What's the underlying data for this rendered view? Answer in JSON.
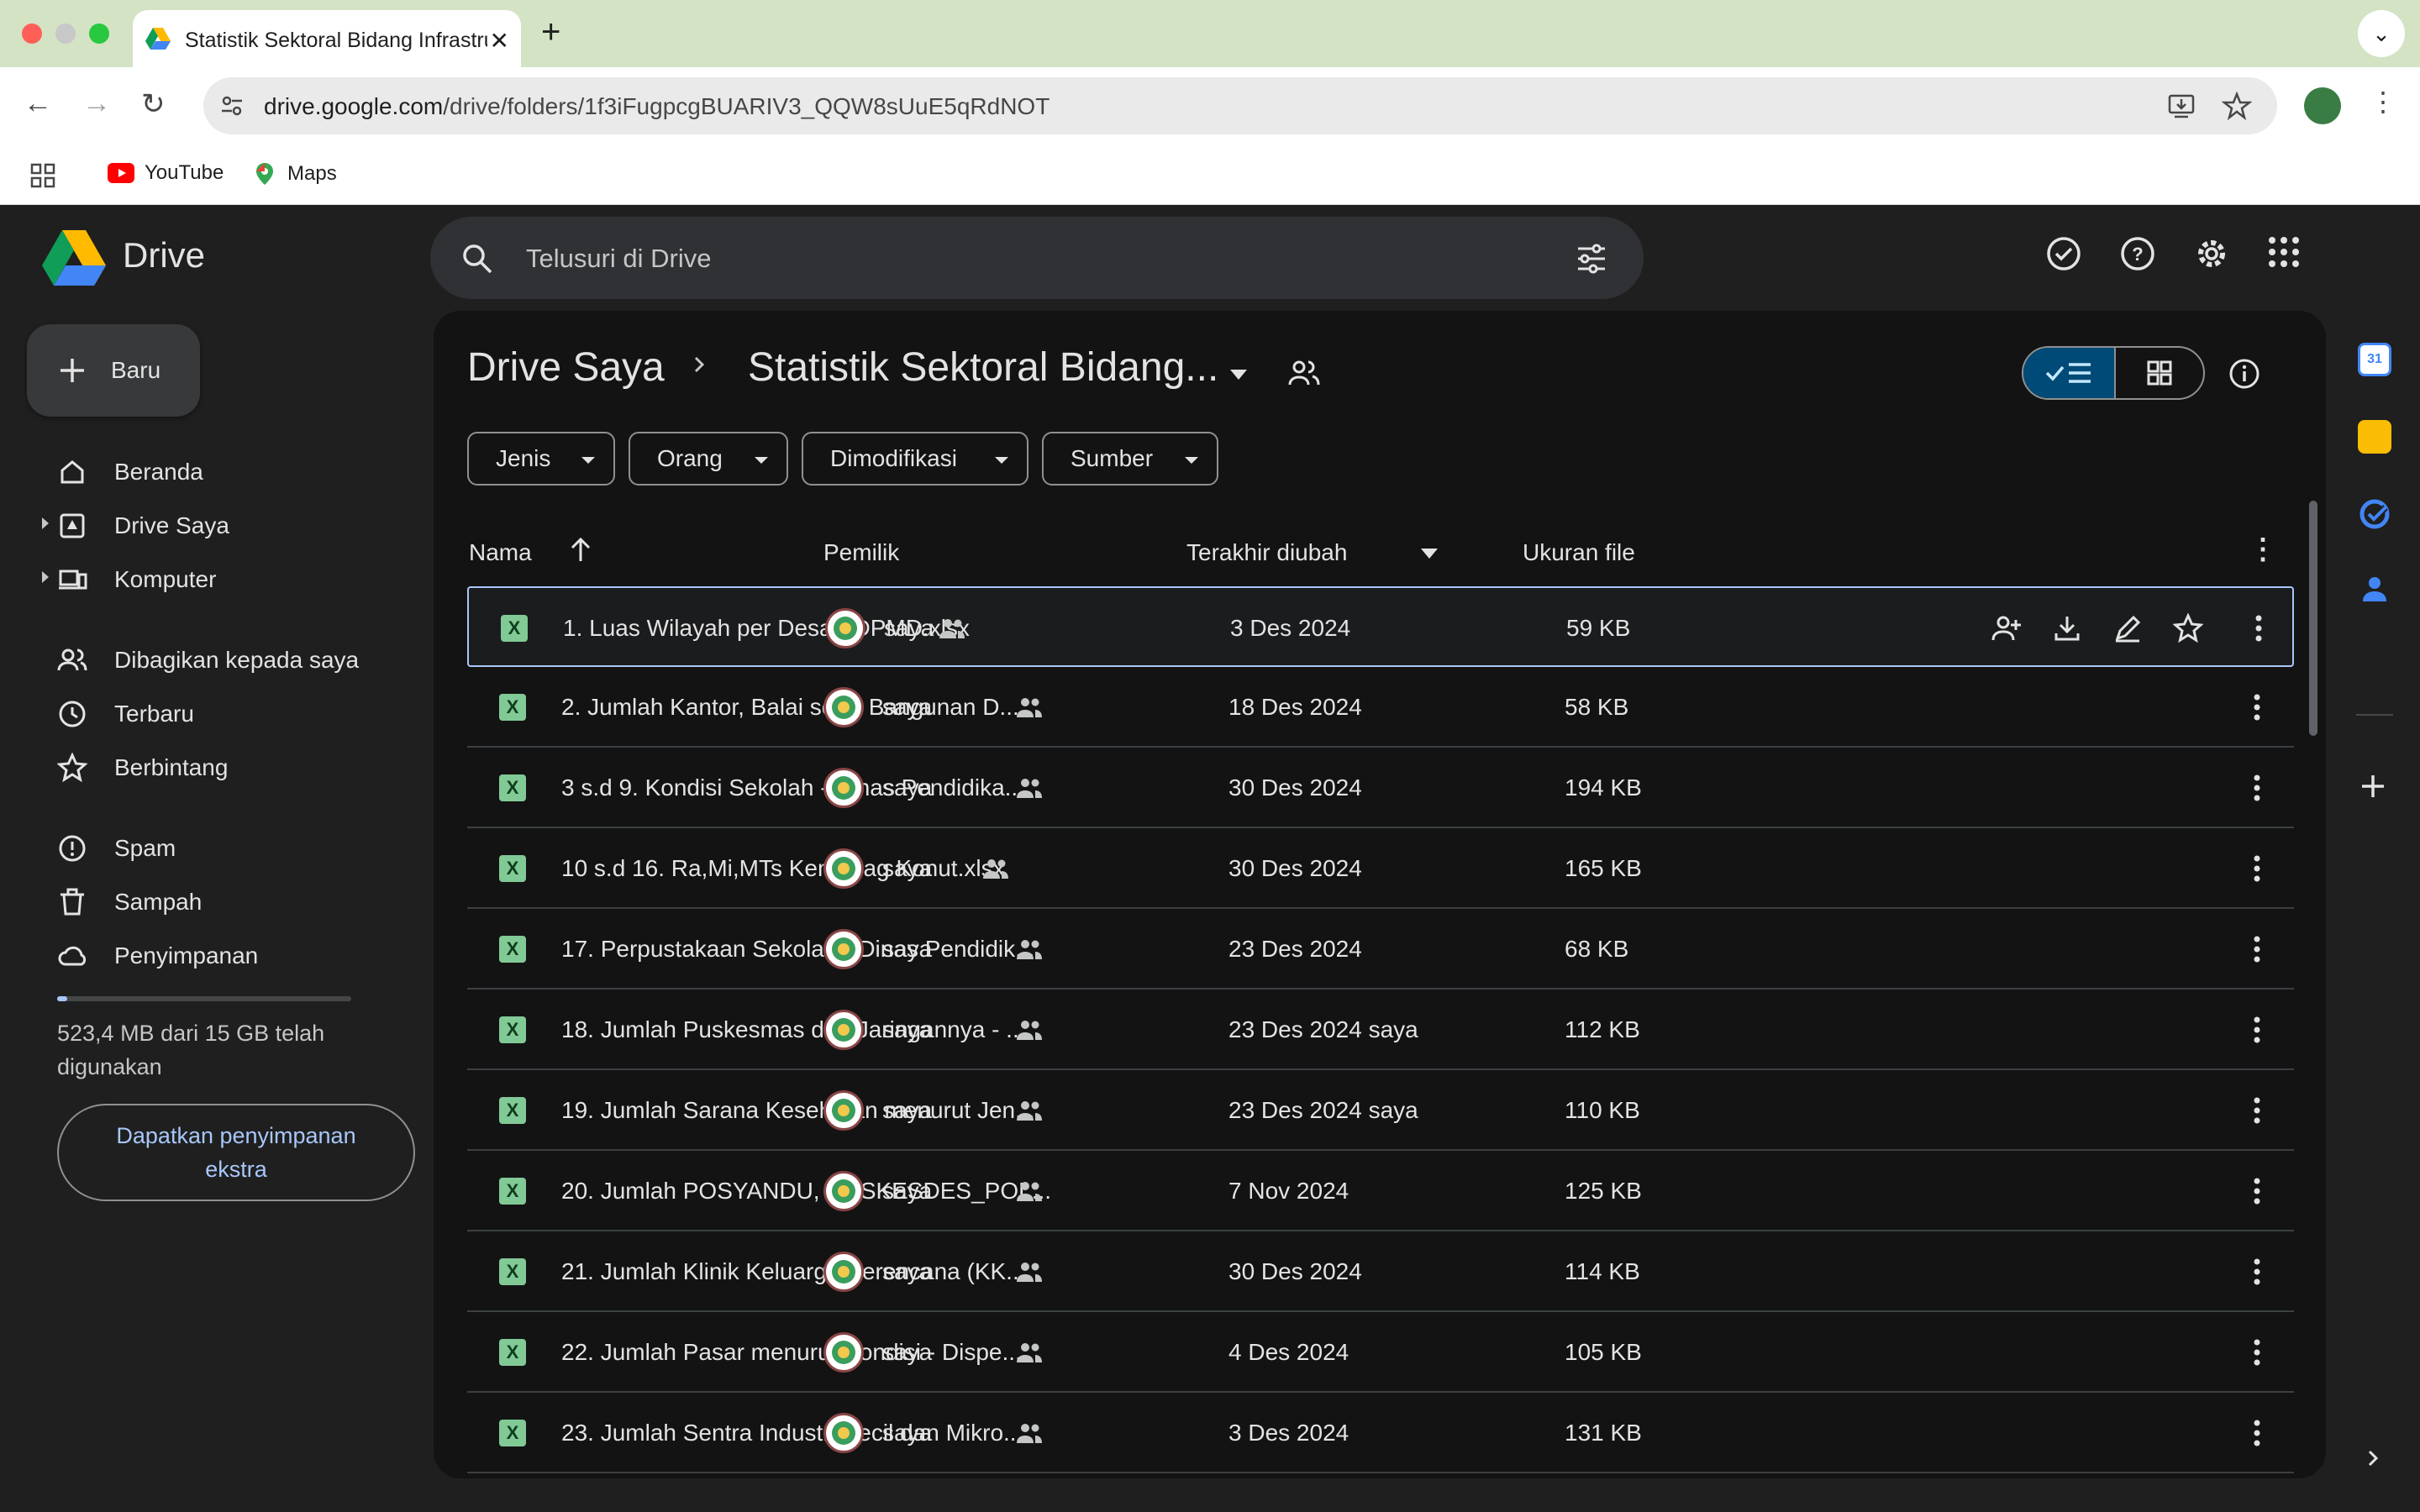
{
  "browser": {
    "tab_title": "Statistik Sektoral Bidang Infrastruktur",
    "url_host": "drive.google.com",
    "url_path": "/drive/folders/1f3iFugpcgBUARIV3_QQW8sUuE5qRdNOT",
    "bookmarks": [
      {
        "label": "YouTube",
        "icon": "youtube-icon"
      },
      {
        "label": "Maps",
        "icon": "maps-icon"
      }
    ]
  },
  "app": {
    "logo": "Drive",
    "search_placeholder": "Telusuri di Drive"
  },
  "sidebar": {
    "new_label": "Baru",
    "items": [
      {
        "label": "Beranda",
        "icon": "home-icon"
      },
      {
        "label": "Drive Saya",
        "icon": "my-drive-icon"
      },
      {
        "label": "Komputer",
        "icon": "computer-icon"
      },
      {
        "label": "Dibagikan kepada saya",
        "icon": "people-icon"
      },
      {
        "label": "Terbaru",
        "icon": "clock-icon"
      },
      {
        "label": "Berbintang",
        "icon": "star-icon"
      },
      {
        "label": "Spam",
        "icon": "spam-icon"
      },
      {
        "label": "Sampah",
        "icon": "trash-icon"
      },
      {
        "label": "Penyimpanan",
        "icon": "cloud-icon"
      }
    ],
    "storage_fraction": 0.035,
    "storage_text": "523,4 MB dari 15 GB telah digunakan",
    "get_storage_label": "Dapatkan penyimpanan ekstra"
  },
  "main": {
    "breadcrumb_root": "Drive Saya",
    "breadcrumb_current": "Statistik Sektoral Bidang...",
    "filters": [
      "Jenis",
      "Orang",
      "Dimodifikasi",
      "Sumber"
    ],
    "columns": {
      "name": "Nama",
      "owner": "Pemilik",
      "modified": "Terakhir diubah",
      "size": "Ukuran file"
    },
    "files": [
      {
        "name": "1. Luas Wilayah per Desa - DPMD.xlsx",
        "owner": "saya",
        "date": "3 Des 2024",
        "by": "",
        "size": "59 KB"
      },
      {
        "name": "2. Jumlah Kantor, Balai serta Bangunan D...",
        "owner": "saya",
        "date": "18 Des 2024",
        "by": "",
        "size": "58 KB"
      },
      {
        "name": "3 s.d 9. Kondisi Sekolah - Dinas Pendidika...",
        "owner": "saya",
        "date": "30 Des 2024",
        "by": "",
        "size": "194 KB"
      },
      {
        "name": "10 s.d 16. Ra,Mi,MTs Kemenag Konut.xlsx",
        "owner": "saya",
        "date": "30 Des 2024",
        "by": "",
        "size": "165 KB"
      },
      {
        "name": "17. Perpustakaan Sekolah - Dinas Pendidik...",
        "owner": "saya",
        "date": "23 Des 2024",
        "by": "",
        "size": "68 KB"
      },
      {
        "name": "18. Jumlah Puskesmas dan Jaringannya - ...",
        "owner": "saya",
        "date": "23 Des 2024",
        "by": "saya",
        "size": "112 KB"
      },
      {
        "name": "19. Jumlah Sarana Kesehatan menurut Jen...",
        "owner": "saya",
        "date": "23 Des 2024",
        "by": "saya",
        "size": "110 KB"
      },
      {
        "name": "20. Jumlah POSYANDU, POSKESDES_POL...",
        "owner": "saya",
        "date": "7 Nov 2024",
        "by": "",
        "size": "125 KB"
      },
      {
        "name": "21. Jumlah Klinik Keluarga Berencana (KK...",
        "owner": "saya",
        "date": "30 Des 2024",
        "by": "",
        "size": "114 KB"
      },
      {
        "name": "22. Jumlah Pasar menurut Kondisi - Dispe...",
        "owner": "saya",
        "date": "4 Des 2024",
        "by": "",
        "size": "105 KB"
      },
      {
        "name": "23. Jumlah Sentra Industri Kecil dan Mikro...",
        "owner": "saya",
        "date": "3 Des 2024",
        "by": "",
        "size": "131 KB"
      }
    ]
  }
}
